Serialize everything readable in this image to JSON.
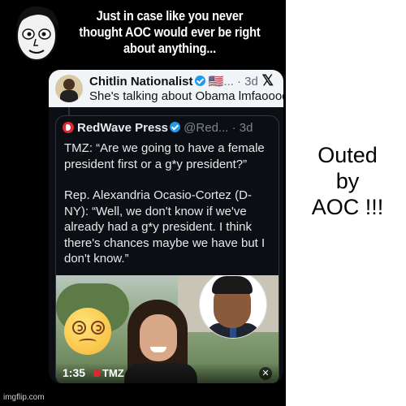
{
  "meme": {
    "caption": "Just in case like you never thought AOC would ever be right about anything...",
    "side_text_lines": [
      "Outed",
      "by",
      "AOC !!!"
    ]
  },
  "tweet": {
    "author": "Chitlin Nationalist",
    "author_meta": " 🇺🇸... · 3d",
    "text": "She's talking about Obama lmfaooooo",
    "quote": {
      "name": "RedWave Press",
      "meta": " @Red... · 3d",
      "paragraph1": "TMZ: “Are we going to have a female president first or a g*y president?”",
      "paragraph2": "Rep. Alexandria Ocasio-Cortez (D-NY): “Well, we don't know if we've already had a g*y president. I think there's chances maybe we have but I don't know.”",
      "video": {
        "time": "1:35",
        "source": "TMZ"
      }
    }
  },
  "watermark": "imgflip.com",
  "icons": [
    "cartoon-face-icon",
    "verified-badge-icon",
    "x-logo-icon",
    "redwave-logo-icon",
    "dizzy-emoji-icon",
    "mute-icon"
  ]
}
